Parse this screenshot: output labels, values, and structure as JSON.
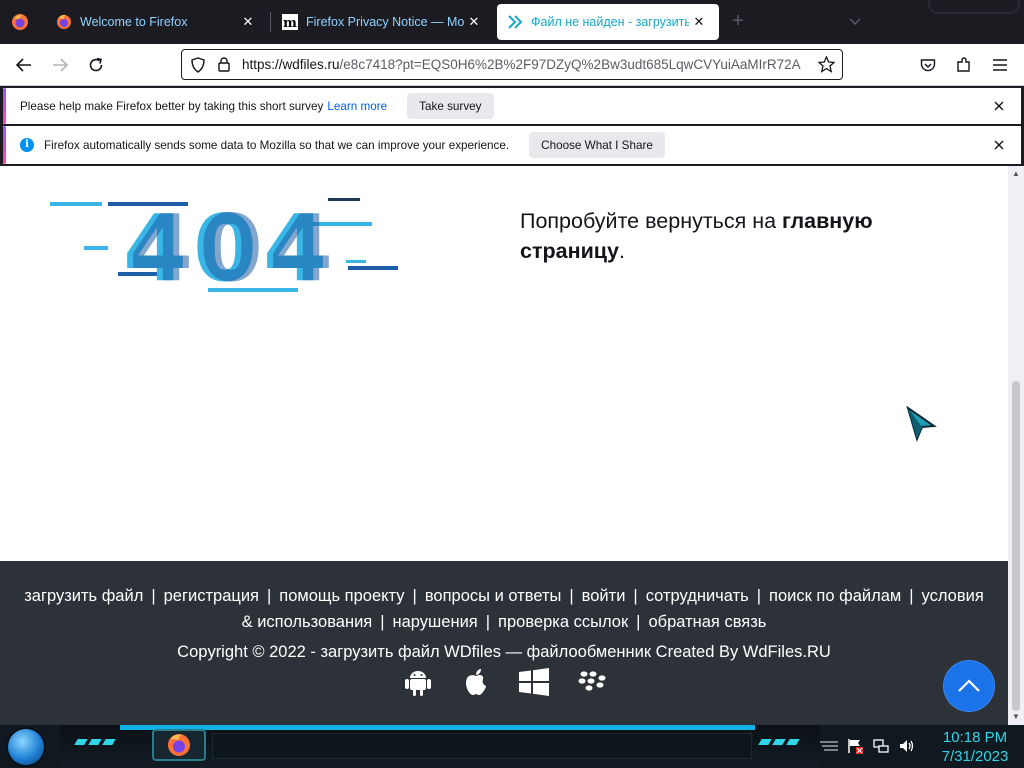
{
  "browser": {
    "tabs": [
      {
        "title": "Welcome to Firefox",
        "favicon": "firefox-icon",
        "active": false
      },
      {
        "title": "Firefox Privacy Notice — Mozilla",
        "favicon": "mozilla-m-icon",
        "active": false
      },
      {
        "title": "Файл не найден - загрузить файл",
        "favicon": "wdfiles-chevron-icon",
        "active": true
      }
    ],
    "url": {
      "host": "https://wdfiles.ru",
      "rest": "/e8c7418?pt=EQS0H6%2B%2F97DZyQ%2Bw3udt685LqwCVYuiAaMIrR72A"
    }
  },
  "notifications": [
    {
      "text": "Please help make Firefox better by taking this short survey",
      "link": "Learn more",
      "button": "Take survey"
    },
    {
      "text": "Firefox automatically sends some data to Mozilla so that we can improve your experience.",
      "button": "Choose What I Share"
    }
  ],
  "page": {
    "error_code": "404",
    "message_prefix": "Попробуйте вернуться на ",
    "message_link": "главную страницу",
    "message_suffix": "."
  },
  "footer": {
    "links": [
      "загрузить файл",
      "регистрация",
      "помощь проекту",
      "вопросы и ответы",
      "войти",
      "сотрудничать",
      "поиск по файлам",
      "условия & использования",
      "нарушения",
      "проверка ссылок",
      "обратная связь"
    ],
    "copyright": "Copyright © 2022 - загрузить файл WDfiles — файлообменник Created By WdFiles.RU",
    "platform_icons": [
      "android-icon",
      "apple-icon",
      "windows-icon",
      "blackberry-icon"
    ]
  },
  "taskbar": {
    "time": "10:18 PM",
    "date": "7/31/2023"
  },
  "colors": {
    "accent_tab_title": "#15a9c8",
    "footer_bg": "#2d3238",
    "to_top_button": "#1a73e8",
    "error_blue_light": "#39b6e6",
    "error_blue_dark": "#1d5fa6",
    "clock": "#2ed6e8"
  }
}
